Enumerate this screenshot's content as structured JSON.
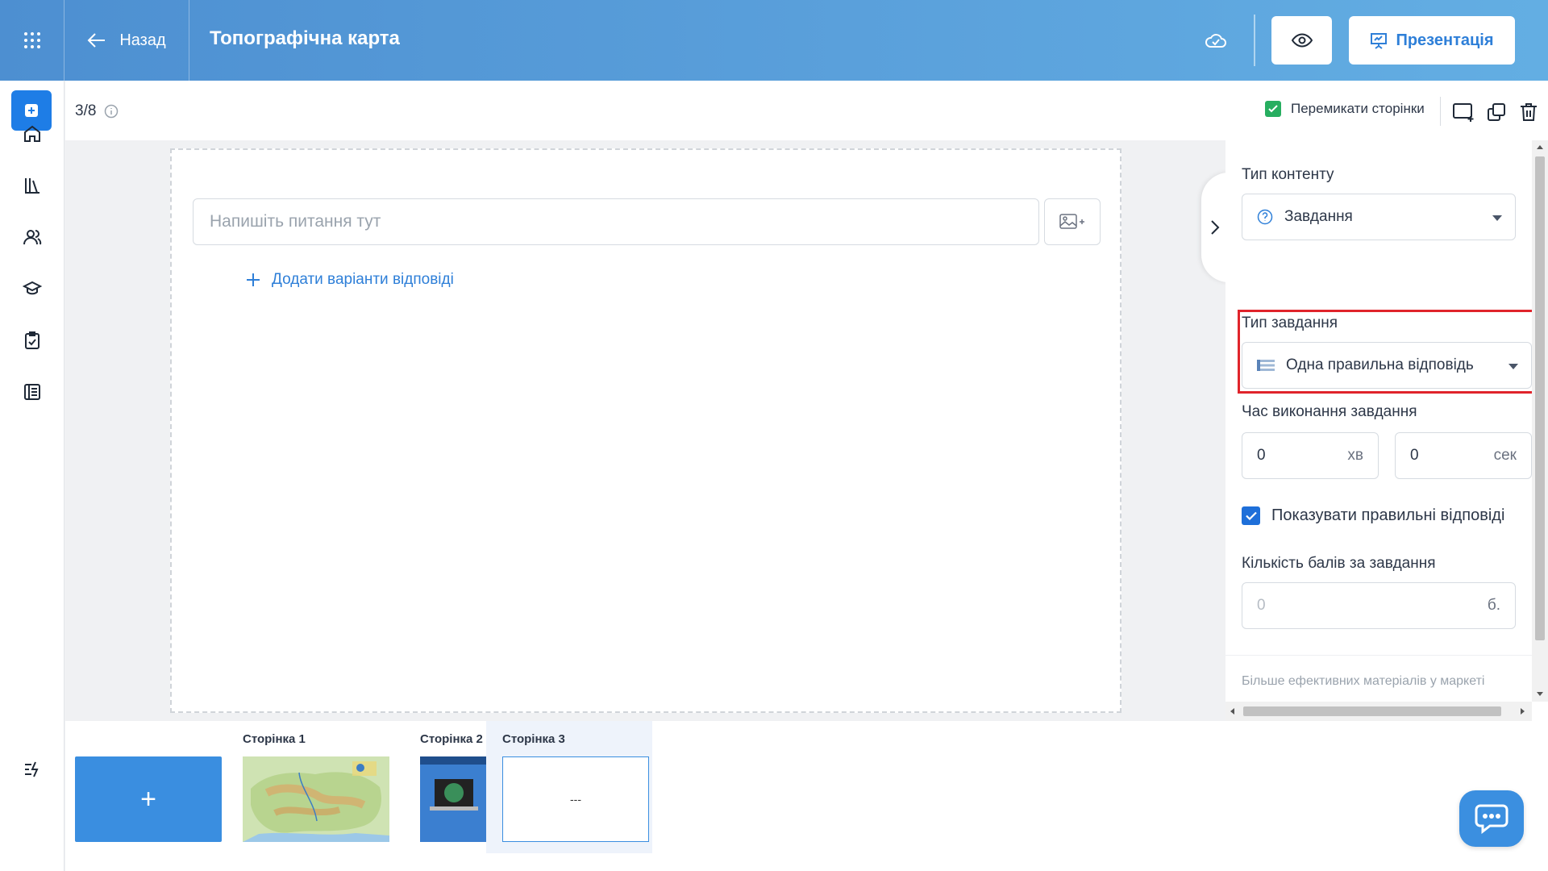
{
  "topbar": {
    "back_label": "Назад",
    "title": "Топографічна карта",
    "present_label": "Презентація",
    "icons": {
      "apps": "apps-grid-icon",
      "back": "arrow-left-icon",
      "cloud": "cloud-check-icon",
      "preview": "eye-icon",
      "present": "presentation-icon"
    }
  },
  "sidebar": {
    "items": [
      {
        "name": "add",
        "icon": "plus-square-icon"
      },
      {
        "name": "home",
        "icon": "home-icon"
      },
      {
        "name": "library",
        "icon": "library-icon"
      },
      {
        "name": "users",
        "icon": "users-icon"
      },
      {
        "name": "courses",
        "icon": "graduation-cap-icon"
      },
      {
        "name": "tasks",
        "icon": "clipboard-check-icon"
      },
      {
        "name": "journal",
        "icon": "journal-icon"
      },
      {
        "name": "feed",
        "icon": "activity-icon"
      }
    ]
  },
  "subheader": {
    "page_counter": "3/8",
    "switch_pages_label": "Перемикати сторінки",
    "switch_pages_checked": true
  },
  "editor": {
    "question_placeholder": "Напишіть питання тут",
    "add_answers_label": "Додати варіанти відповіді"
  },
  "settings": {
    "content_type_label": "Тип контенту",
    "content_type_value": "Завдання",
    "task_type_label": "Тип завдання",
    "task_type_value": "Одна правильна відповідь",
    "time_label": "Час виконання завдання",
    "minutes_value": "0",
    "minutes_unit": "хв",
    "seconds_value": "0",
    "seconds_unit": "сек",
    "show_answers_label": "Показувати правильні відповіді",
    "show_answers_checked": true,
    "points_label": "Кількість балів за завдання",
    "points_placeholder": "0",
    "points_unit": "б.",
    "market_link": "Більше ефективних матеріалів у маркеті"
  },
  "pages": {
    "add_label": "+",
    "items": [
      {
        "label": "Сторінка 1",
        "active": false
      },
      {
        "label": "Сторінка 2",
        "active": false
      },
      {
        "label": "Сторінка 3",
        "active": true,
        "preview_text": "---"
      }
    ]
  },
  "colors": {
    "primary": "#1e7de6",
    "topbar_start": "#4d8fd1",
    "topbar_end": "#63aee3",
    "highlight": "#e0242b",
    "check_green": "#27ae60"
  }
}
